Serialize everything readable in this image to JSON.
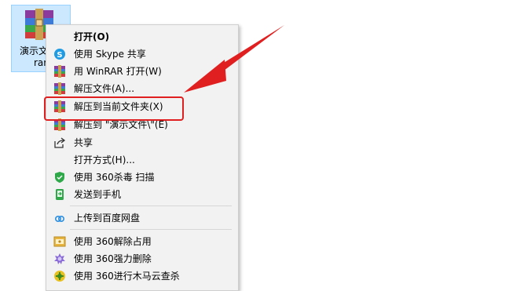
{
  "desktop": {
    "file_label_line1": "演示文",
    "file_label_line2": "rar",
    "icon": "winrar-archive-icon"
  },
  "menu": {
    "items": [
      {
        "label": "打开(O)",
        "icon": "none"
      },
      {
        "label": "使用 Skype 共享",
        "icon": "skype-icon"
      },
      {
        "label": "用 WinRAR 打开(W)",
        "icon": "winrar-icon"
      },
      {
        "label": "解压文件(A)...",
        "icon": "winrar-icon"
      },
      {
        "label": "解压到当前文件夹(X)",
        "icon": "winrar-icon"
      },
      {
        "label": "解压到 \"演示文件\\\"(E)",
        "icon": "winrar-icon"
      },
      {
        "label": "共享",
        "icon": "share-icon"
      },
      {
        "label": "打开方式(H)...",
        "icon": "none"
      },
      {
        "label": "使用 360杀毒 扫描",
        "icon": "shield-icon"
      },
      {
        "label": "发送到手机",
        "icon": "phone-icon"
      },
      {
        "label": "上传到百度网盘",
        "icon": "baidu-cloud-icon"
      },
      {
        "label": "使用 360解除占用",
        "icon": "unlock-icon"
      },
      {
        "label": "使用 360强力删除",
        "icon": "delete-icon"
      },
      {
        "label": "使用 360进行木马云查杀",
        "icon": "trojan-scan-icon"
      }
    ]
  },
  "colors": {
    "highlight": "#e02020",
    "arrow": "#e02020",
    "selection_tile": "#cce8ff"
  }
}
